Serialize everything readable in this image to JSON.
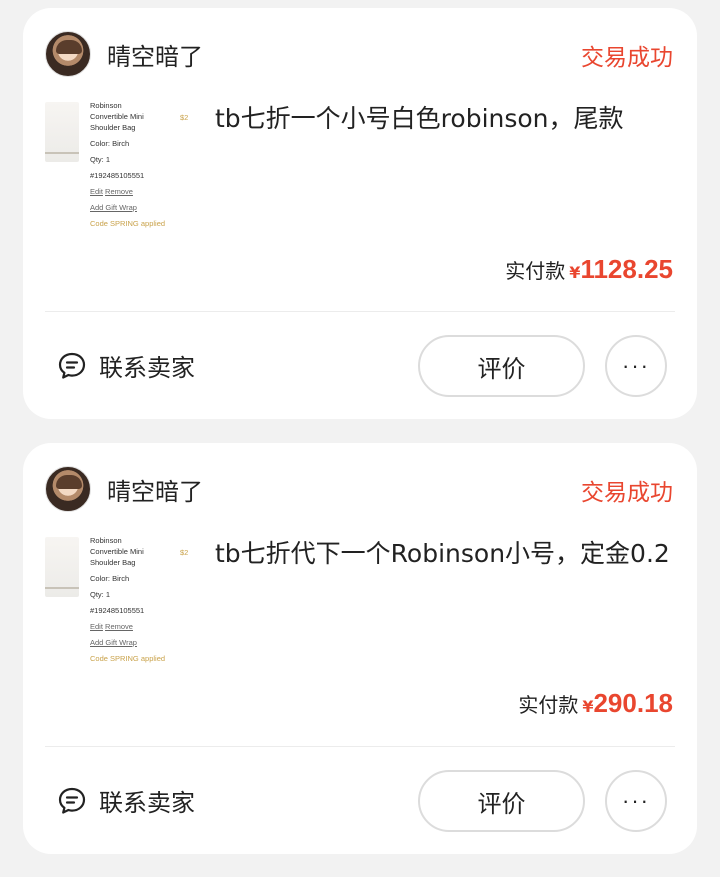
{
  "orders": [
    {
      "seller_name": "晴空暗了",
      "status": "交易成功",
      "title": "tb七折一个小号白色robinson，尾款",
      "pay_label": "实付款",
      "currency": "¥",
      "amount": "1128.25",
      "thumb": {
        "lines": [
          "Robinson",
          "Convertible Mini",
          "Shoulder Bag",
          "Color: Birch",
          "Qty: 1",
          "#192485105551"
        ],
        "edit": "Edit",
        "remove": "Remove",
        "gift": "Add Gift Wrap",
        "code": "Code SPRING applied",
        "price": "$2"
      },
      "contact_label": "联系卖家",
      "review_label": "评价",
      "more_label": "···"
    },
    {
      "seller_name": "晴空暗了",
      "status": "交易成功",
      "title": "tb七折代下一个Robinson小号，定金0.2",
      "pay_label": "实付款",
      "currency": "¥",
      "amount": "290.18",
      "thumb": {
        "lines": [
          "Robinson",
          "Convertible Mini",
          "Shoulder Bag",
          "Color: Birch",
          "Qty: 1",
          "#192485105551"
        ],
        "edit": "Edit",
        "remove": "Remove",
        "gift": "Add Gift Wrap",
        "code": "Code SPRING applied",
        "price": "$2"
      },
      "contact_label": "联系卖家",
      "review_label": "评价",
      "more_label": "···"
    }
  ],
  "colors": {
    "accent": "#e9462f",
    "background": "#f2f2f2",
    "card": "#ffffff"
  }
}
